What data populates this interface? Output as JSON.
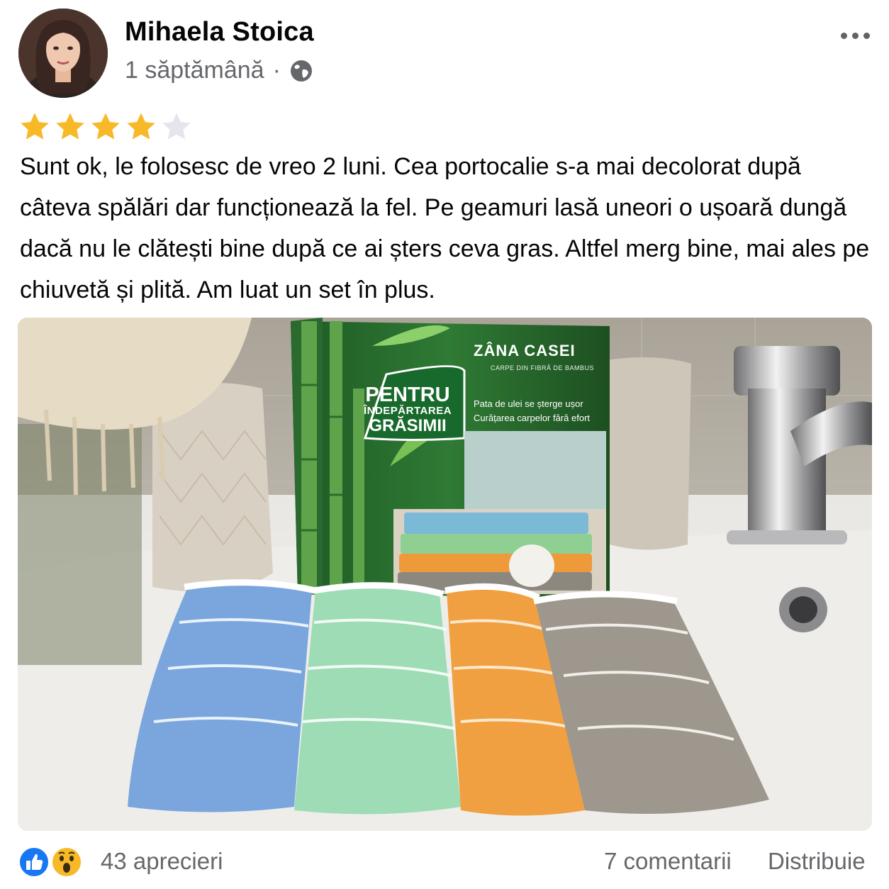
{
  "post": {
    "author": {
      "name": "Mihaela Stoica",
      "avatar": "profile-photo"
    },
    "time": "1 săptămână",
    "separator": "·",
    "audience_icon": "globe-icon",
    "menu_icon": "more-horizontal-icon",
    "rating": {
      "value": 4,
      "max": 5,
      "filled_color": "#f7b928",
      "empty_color": "#e4e6eb"
    },
    "text": "Sunt ok, le folosesc de vreo 2 luni. Cea portocalie s-a mai decolorat după câteva spălări dar funcționează la fel. Pe geamuri lasă uneori o ușoară dungă dacă nu le clătești bine după ce ai șters ceva gras. Altfel merg bine, mai ales pe chiuvetă și plită. Am luat un set în plus.",
    "photo": {
      "description_icon": "product-photo",
      "box": {
        "brand": "ZÂNA CASEI",
        "subtitle": "CARPE DIN FIBRĂ DE BAMBUS",
        "badge_line1": "PENTRU",
        "badge_line2": "ÎNDEPĂRTAREA",
        "badge_line3": "GRĂSIMII",
        "claim1": "Pata de ulei se șterge ușor",
        "claim2": "Curățarea carpelor fără efort"
      },
      "cloth_colors": [
        "#7aa6dd",
        "#9ddcb5",
        "#f0a040",
        "#9e978d"
      ]
    }
  },
  "footer": {
    "reactions": [
      "like-icon",
      "wow-icon"
    ],
    "likes": "43 aprecieri",
    "comments": "7 comentarii",
    "share": "Distribuie"
  },
  "colors": {
    "meta_text": "#65676b",
    "like_blue": "#1877f2",
    "wow_yellow": "#f7b928"
  }
}
